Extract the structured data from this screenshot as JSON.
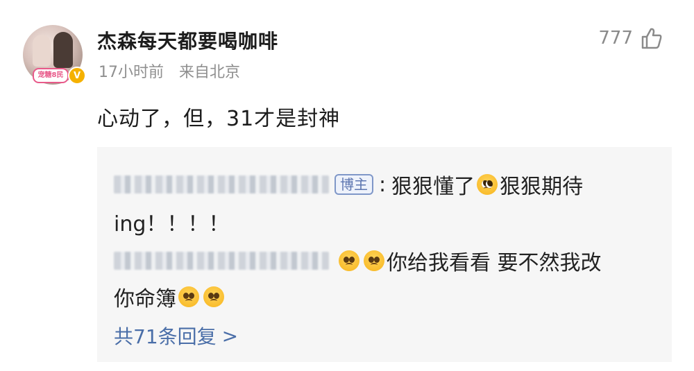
{
  "post": {
    "username": "杰森每天都要喝咖啡",
    "time": "17小时前",
    "source": "来自北京",
    "like_count": "777",
    "content": "心动了，但，31才是封神",
    "avatar_tag": "宠糖8民",
    "verified_badge": "V"
  },
  "replies": [
    {
      "author_blurred": true,
      "tag": "博主",
      "separator": ":",
      "text1": "狠狠懂了",
      "text2": "狠狠期待",
      "text3": "ing！！！！"
    },
    {
      "author_blurred": true,
      "text1": "你给我看看 要不然我改",
      "text2": "你命簿"
    }
  ],
  "more_replies": {
    "label": "共71条回复",
    "chevron": ">"
  },
  "icons": {
    "like": "thumbs-up-icon",
    "emoji_pleading": "pleading-face-icon",
    "emoji_sad": "sad-face-icon"
  },
  "colors": {
    "link_blue": "#4a6ea8",
    "meta_gray": "#8f8f8f",
    "reply_bg": "#f6f6f6",
    "verified": "#f5b100"
  }
}
